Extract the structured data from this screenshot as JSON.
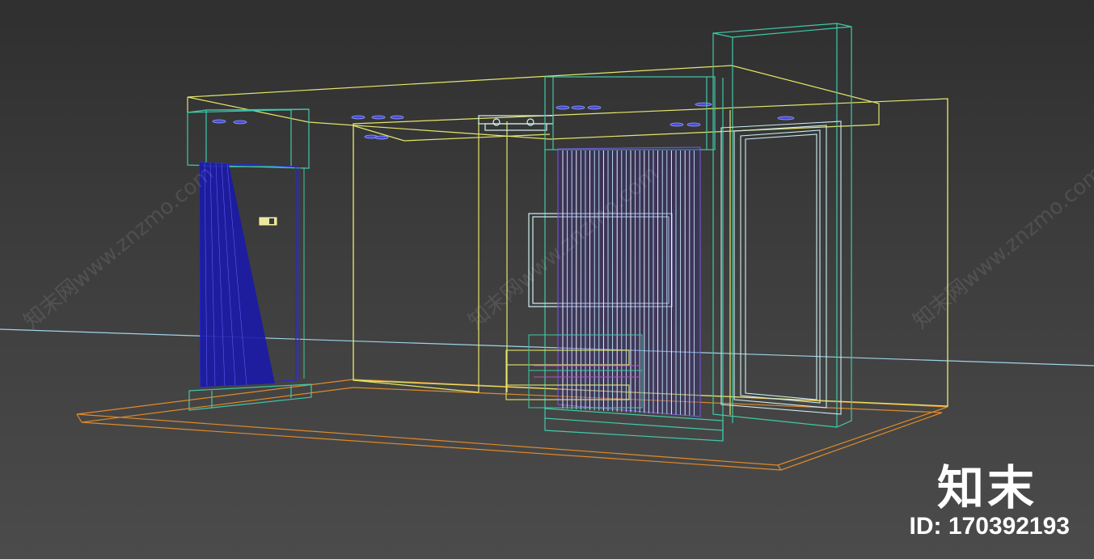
{
  "watermark": {
    "text": "知末网www.znzmo.com"
  },
  "brand": {
    "logo_text": "知末",
    "id_text": "ID: 170392193"
  },
  "colors": {
    "background_top": "#2f2f2f",
    "background_bottom": "#4b4b4b",
    "horizon": "#9fd3e6",
    "room_wireframe": "#e3e66a",
    "floor_slab": "#e08a2a",
    "teal_objects": "#40c9a8",
    "blue_door": "#1a1aa8",
    "cyan_panels": "#cfeff5",
    "spot_lights": "#6a5ae0"
  },
  "icons": [
    "light-switch-icon"
  ]
}
